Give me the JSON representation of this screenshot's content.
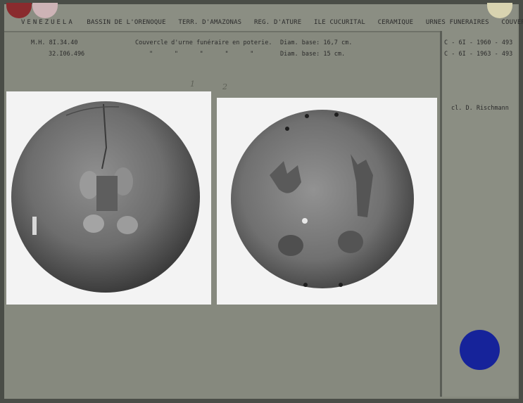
{
  "header": {
    "items": [
      "VENEZUELA",
      "BASSIN DE L'ORENOQUE",
      "TERR. D'AMAZONAS",
      "REG. D'ATURE",
      "ILE CUCURITAL",
      "CERAMIQUE",
      "URNES FUNERAIRES",
      "COUVERCLES"
    ]
  },
  "record": {
    "inv1": "M.H. 8I.34.40",
    "inv2": "32.I06.496",
    "desc1": "Couvercle d'urne funéraire en poterie.",
    "diam1": "Diam. base: 16,7 cm.",
    "ditto": "\"      \"      \"      \"      \"",
    "diam2": "Diam. base: 15 cm."
  },
  "refs": {
    "ref1": "C - 6I - 1960 - 493",
    "ref2": "C - 6I - 1963 - 493",
    "credit": "cl. D. Rischmann"
  },
  "marks": {
    "m1": "1",
    "m2": "2"
  },
  "colors": {
    "red_tab": "#8a2b2e",
    "pink_tab": "#cdb3b6",
    "cream_tab": "#d8d3b0",
    "blue_dot": "#16239a"
  }
}
